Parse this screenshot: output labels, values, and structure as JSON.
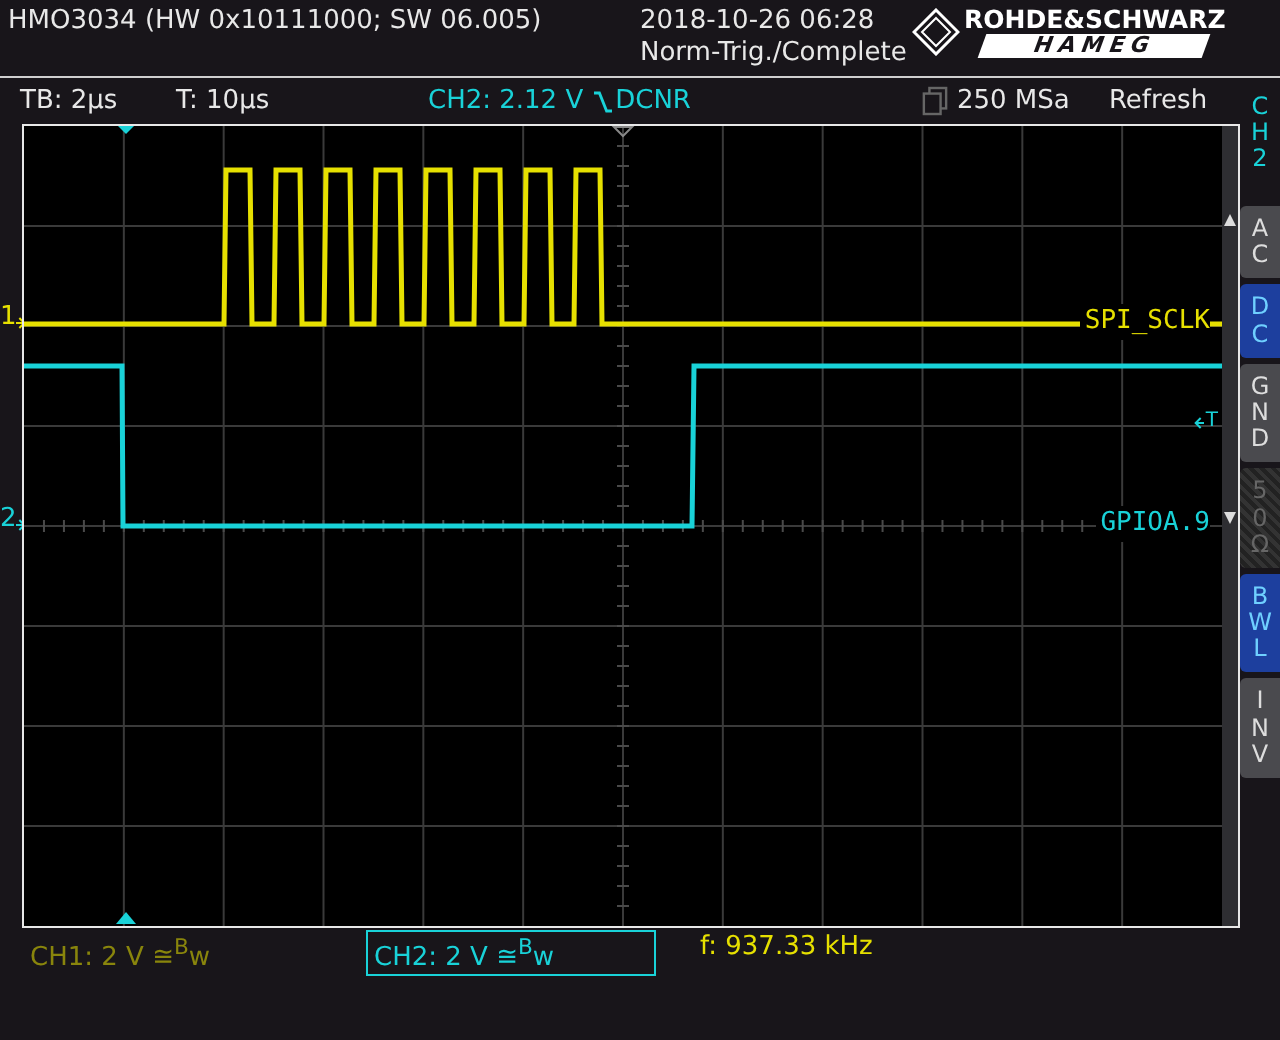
{
  "header": {
    "title": "HMO3034 (HW 0x10111000; SW 06.005)",
    "datetime": "2018-10-26 06:28",
    "status": "Norm-Trig./Complete",
    "logo_top": "ROHDE&SCHWARZ",
    "logo_bottom": "HAMEG"
  },
  "info_bar": {
    "timebase": "TB: 2µs",
    "trigger_time": "T: 10µs",
    "trigger_source": "CH2: 2.12 V",
    "trigger_mode": "DCNR",
    "sample_rate": "250 MSa",
    "acquisition": "Refresh"
  },
  "channels": [
    {
      "marker": "1",
      "label": "SPI_SCLK",
      "color": "#e6e000",
      "scale": "CH1: 2 V ≅$^{B}$w",
      "selected": false
    },
    {
      "marker": "2",
      "label": "GPIOA.9",
      "color": "#19d2d8",
      "scale": "CH2: 2 V ≅$^{B}$w",
      "selected": true
    }
  ],
  "trigger_marker": "T",
  "frequency": "f: 937.33 kHz",
  "side_menu": {
    "title": "CH2",
    "buttons": [
      {
        "label": "AC",
        "selected": false,
        "disabled": false
      },
      {
        "label": "DC",
        "selected": true,
        "disabled": false
      },
      {
        "label": "GND",
        "selected": false,
        "disabled": false
      },
      {
        "label": "50Ω",
        "selected": false,
        "disabled": true
      },
      {
        "label": "BWL",
        "selected": true,
        "disabled": false
      },
      {
        "label": "INV",
        "selected": false,
        "disabled": false
      }
    ]
  }
}
